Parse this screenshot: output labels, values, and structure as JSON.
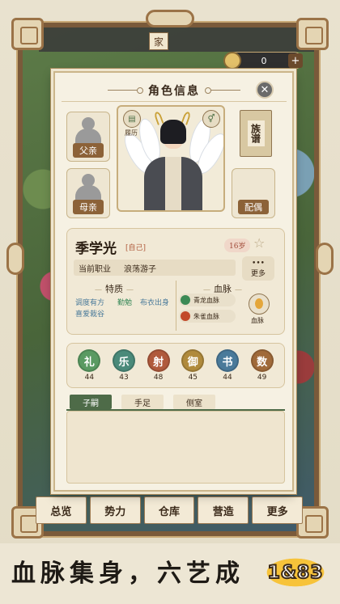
{
  "scene": {
    "resource_value": "0",
    "resource_plus": "+",
    "family_tag": "家",
    "bottom_nav": [
      "总览",
      "势力",
      "仓库",
      "营造",
      "更多"
    ]
  },
  "modal": {
    "title": "角色信息",
    "close": "✕",
    "father_label": "父亲",
    "mother_label": "母亲",
    "spouse_label": "配偶",
    "genealogy_label": "族谱",
    "resume_label": "履历",
    "character": {
      "name": "季学光",
      "self_tag": "[自己]",
      "age": "16岁",
      "star": "☆",
      "job_label": "当前职业",
      "job_value": "浪荡游子",
      "more_dots": "•••",
      "more_label": "更多",
      "traits_title": "特质",
      "traits": [
        {
          "text": "调度有方",
          "color": "#4a7a9a"
        },
        {
          "text": "勤勉",
          "color": "#3a8a5a"
        },
        {
          "text": "布衣出身",
          "color": "#4a7a9a"
        },
        {
          "text": "喜爱栽谷",
          "color": "#4a7a9a"
        }
      ],
      "bloodline_title": "血脉",
      "bloodlines": [
        {
          "text": "青龙血脉",
          "color": "#3c8a55"
        },
        {
          "text": "朱雀血脉",
          "color": "#c24a2a"
        }
      ],
      "bloodline_icon_label": "血脉"
    },
    "arts": [
      {
        "glyph": "礼",
        "value": "44",
        "color": "#5a9a62"
      },
      {
        "glyph": "乐",
        "value": "43",
        "color": "#4a8a7a"
      },
      {
        "glyph": "射",
        "value": "48",
        "color": "#b05a3c"
      },
      {
        "glyph": "御",
        "value": "45",
        "color": "#b08a3c"
      },
      {
        "glyph": "书",
        "value": "44",
        "color": "#4a7a9a"
      },
      {
        "glyph": "数",
        "value": "49",
        "color": "#a06a3a"
      }
    ],
    "tabs": [
      "子嗣",
      "手足",
      "侧室"
    ]
  },
  "banner": {
    "slogan": "血脉集身，六艺成",
    "logo": "1&83"
  }
}
